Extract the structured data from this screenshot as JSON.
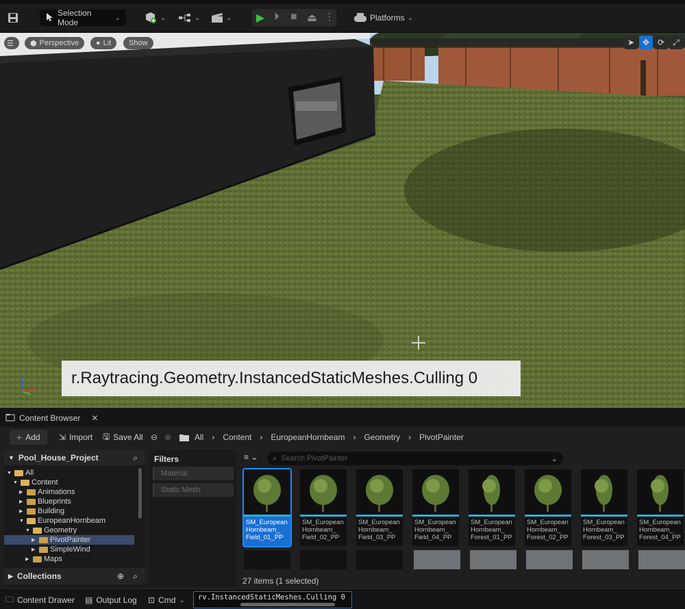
{
  "toolbar": {
    "selection_mode": "Selection Mode",
    "platforms": "Platforms"
  },
  "viewport": {
    "perspective": "Perspective",
    "lit": "Lit",
    "show": "Show",
    "command_overlay": "r.Raytracing.Geometry.InstancedStaticMeshes.Culling 0"
  },
  "content_browser": {
    "tab_title": "Content Browser",
    "add": "Add",
    "import": "Import",
    "save_all": "Save All",
    "breadcrumb": [
      "All",
      "Content",
      "EuropeanHornbeam",
      "Geometry",
      "PivotPainter"
    ],
    "project": "Pool_House_Project",
    "tree": [
      {
        "label": "All",
        "indent": 0,
        "open": true
      },
      {
        "label": "Content",
        "indent": 1,
        "open": true
      },
      {
        "label": "Animations",
        "indent": 2
      },
      {
        "label": "Blueprints",
        "indent": 2
      },
      {
        "label": "Building",
        "indent": 2
      },
      {
        "label": "EuropeanHornbeam",
        "indent": 2,
        "open": true
      },
      {
        "label": "Geometry",
        "indent": 3,
        "open": true
      },
      {
        "label": "PivotPainter",
        "indent": 4,
        "selected": true
      },
      {
        "label": "SimpleWind",
        "indent": 4
      },
      {
        "label": "Maps",
        "indent": 3
      }
    ],
    "collections": "Collections",
    "filters_title": "Filters",
    "filters": [
      "Material",
      "Static Mesh"
    ],
    "search_placeholder": "Search PivotPainter",
    "assets": [
      "SM_European Hornbeam_ Field_01_PP",
      "SM_European Hornbeam_ Field_02_PP",
      "SM_European Hornbeam_ Field_03_PP",
      "SM_European Hornbeam_ Field_04_PP",
      "SM_European Hornbeam_ Forest_01_PP",
      "SM_European Hornbeam_ Forest_02_PP",
      "SM_European Hornbeam_ Forest_03_PP",
      "SM_European Hornbeam_ Forest_04_PP"
    ],
    "items_count": "27 items (1 selected)"
  },
  "statusbar": {
    "content_drawer": "Content Drawer",
    "output_log": "Output Log",
    "cmd": "Cmd",
    "cmd_value": "rv.InstancedStaticMeshes.Culling 0"
  }
}
